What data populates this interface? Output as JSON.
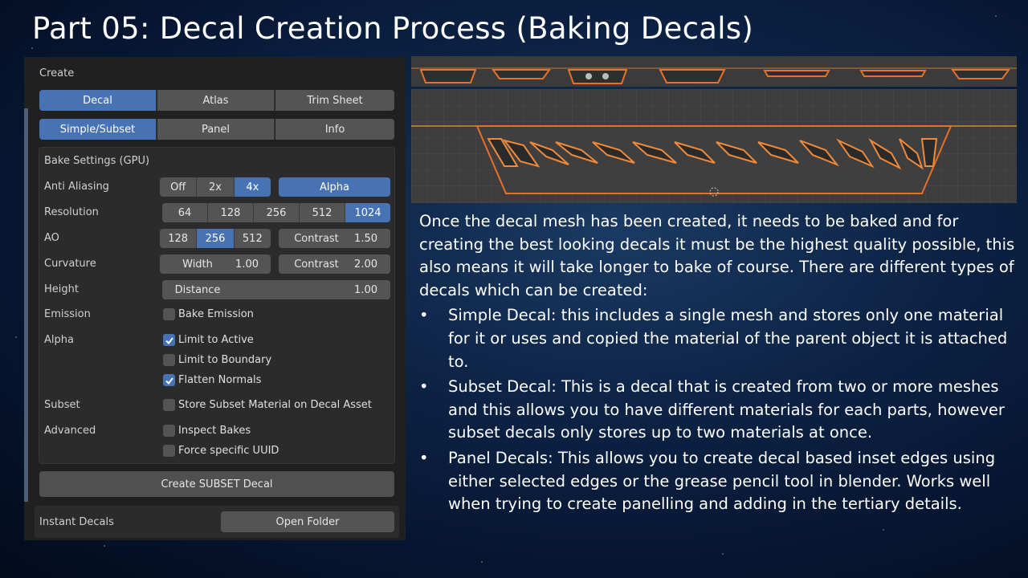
{
  "slide_title": "Part 05: Decal Creation Process (Baking Decals)",
  "panel": {
    "create_label": "Create",
    "type_tabs": [
      {
        "label": "Decal",
        "active": true
      },
      {
        "label": "Atlas",
        "active": false
      },
      {
        "label": "Trim Sheet",
        "active": false
      }
    ],
    "mode_tabs": [
      {
        "label": "Simple/Subset",
        "active": true
      },
      {
        "label": "Panel",
        "active": false
      },
      {
        "label": "Info",
        "active": false
      }
    ],
    "bake_settings_label": "Bake Settings (GPU)",
    "anti_aliasing": {
      "label": "Anti Aliasing",
      "options": [
        "Off",
        "2x",
        "4x"
      ],
      "selected": "4x",
      "alpha_label": "Alpha"
    },
    "resolution": {
      "label": "Resolution",
      "options": [
        "64",
        "128",
        "256",
        "512",
        "1024"
      ],
      "selected": "1024"
    },
    "ao": {
      "label": "AO",
      "options": [
        "128",
        "256",
        "512"
      ],
      "selected": "256",
      "contrast_label": "Contrast",
      "contrast_value": "1.50"
    },
    "curvature": {
      "label": "Curvature",
      "width_label": "Width",
      "width_value": "1.00",
      "contrast_label": "Contrast",
      "contrast_value": "2.00"
    },
    "height": {
      "label": "Height",
      "distance_label": "Distance",
      "distance_value": "1.00"
    },
    "emission": {
      "label": "Emission",
      "checkbox_label": "Bake Emission",
      "checked": false
    },
    "alpha": {
      "label": "Alpha",
      "limit_active": "Limit to Active",
      "limit_boundary": "Limit to Boundary",
      "flatten_normals": "Flatten Normals"
    },
    "subset": {
      "label": "Subset",
      "checkbox_label": "Store Subset Material on Decal Asset"
    },
    "advanced": {
      "label": "Advanced",
      "inspect_bakes": "Inspect Bakes",
      "force_uuid": "Force specific UUID"
    },
    "create_button": "Create SUBSET Decal",
    "instant_decals_label": "Instant Decals",
    "open_folder_button": "Open Folder"
  },
  "colors": {
    "accent": "#4772b3",
    "outline": "#e8702a"
  },
  "body": {
    "intro": "Once the decal mesh has been created, it needs to be baked and for creating the best looking decals it must be the highest quality possible, this also means it will take longer to bake of course. There are different types of decals which can be created:",
    "bullet_symbol": "•",
    "bullets": [
      "Simple Decal: this includes a single mesh and stores only one material for it or uses and copied the material of the parent object it is attached to.",
      "Subset Decal: This is a decal that is created from two or more meshes and this allows you to have different materials for each parts, however subset decals only stores up to two materials at once.",
      "Panel Decals: This allows you to create decal based inset edges using either selected edges or the grease pencil tool in blender. Works well when trying to create panelling and adding in the tertiary details."
    ]
  }
}
